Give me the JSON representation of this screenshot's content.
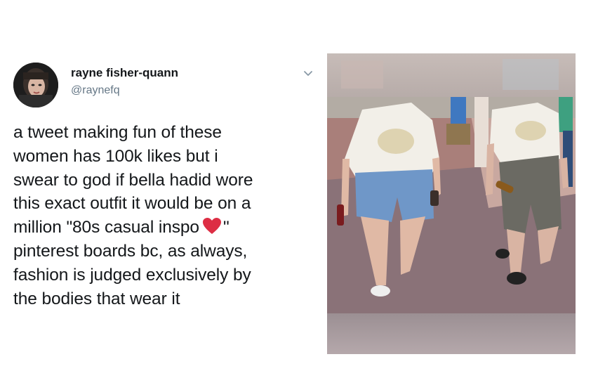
{
  "tweet": {
    "display_name": "rayne fisher-quann",
    "handle": "@raynefq",
    "lines": [
      "a tweet making fun of these",
      "women has 100k likes but i",
      "swear to god if bella hadid wore",
      "this exact outfit it would be on a",
      "million \"80s casual inspo",
      "\"",
      "pinterest boards bc, as always,",
      "fashion is judged exclusively by",
      "the bodies that wear it"
    ],
    "heart_color": "#dd2e44",
    "menu_icon": "chevron-down-icon"
  },
  "photo": {
    "icon": "street-photo"
  }
}
